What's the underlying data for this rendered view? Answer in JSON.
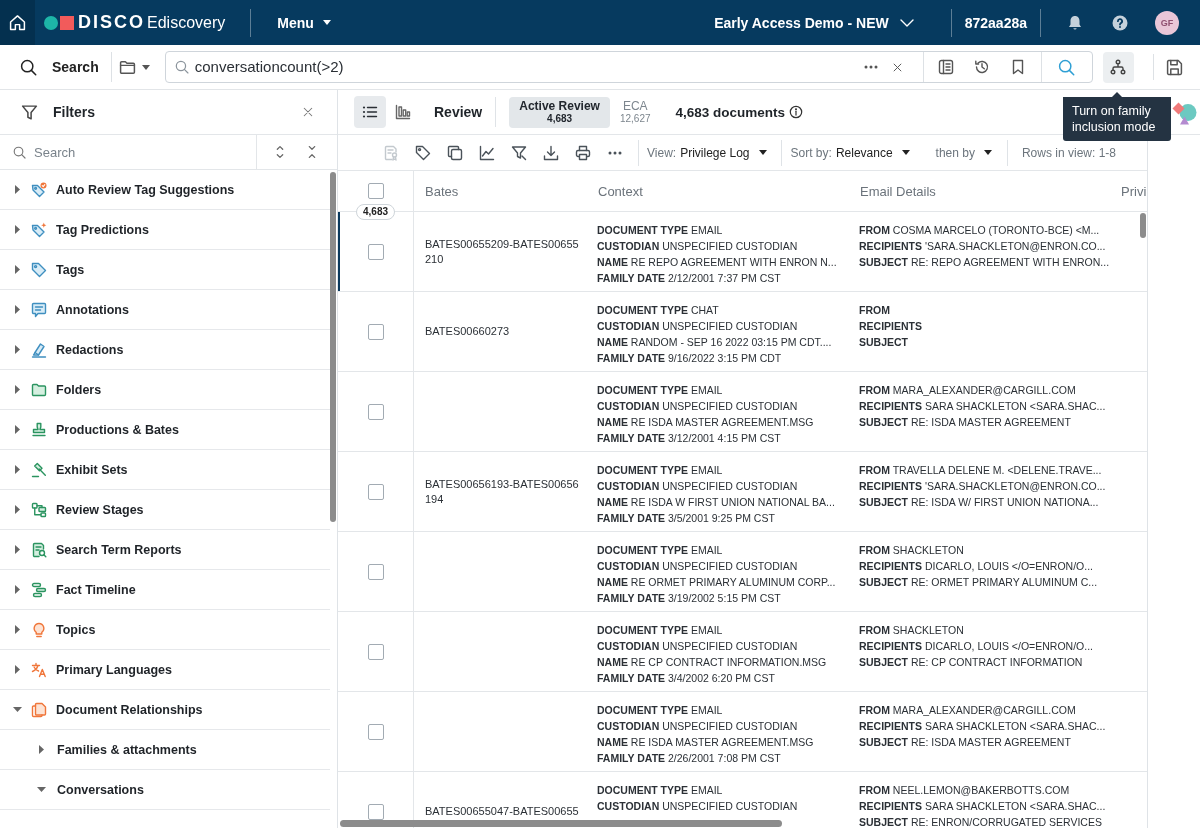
{
  "header": {
    "brand": "DISCO",
    "product": "Ediscovery",
    "menu": "Menu",
    "workspace": "Early Access Demo - NEW",
    "session_id": "872aa28a",
    "avatar": "GF"
  },
  "search_bar": {
    "label": "Search",
    "query": "conversationcount(>2)",
    "family_tooltip": "Turn on family inclusion mode"
  },
  "filters": {
    "title": "Filters",
    "search_placeholder": "Search",
    "items": [
      {
        "label": "Auto Review Tag Suggestions",
        "expanded": false
      },
      {
        "label": "Tag Predictions",
        "expanded": false
      },
      {
        "label": "Tags",
        "expanded": false
      },
      {
        "label": "Annotations",
        "expanded": false
      },
      {
        "label": "Redactions",
        "expanded": false
      },
      {
        "label": "Folders",
        "expanded": false
      },
      {
        "label": "Productions & Bates",
        "expanded": false
      },
      {
        "label": "Exhibit Sets",
        "expanded": false
      },
      {
        "label": "Review Stages",
        "expanded": false
      },
      {
        "label": "Search Term Reports",
        "expanded": false
      },
      {
        "label": "Fact Timeline",
        "expanded": false
      },
      {
        "label": "Topics",
        "expanded": false
      },
      {
        "label": "Primary Languages",
        "expanded": false
      },
      {
        "label": "Document Relationships",
        "expanded": true,
        "children": [
          {
            "label": "Families & attachments",
            "expanded": false
          },
          {
            "label": "Conversations",
            "expanded": true
          }
        ]
      }
    ]
  },
  "review": {
    "view_modes": [
      {
        "selected": true
      },
      {
        "selected": false
      }
    ],
    "title": "Review",
    "tabs": [
      {
        "label": "Active Review",
        "count": "4,683",
        "selected": true
      },
      {
        "label": "ECA",
        "count": "12,627",
        "selected": false
      }
    ],
    "summary": "4,683 documents"
  },
  "toolbar": {
    "actions": [
      {
        "disabled": true
      },
      {
        "disabled": false
      },
      {
        "disabled": false
      },
      {
        "disabled": false
      },
      {
        "disabled": false
      },
      {
        "disabled": false
      },
      {
        "disabled": false
      },
      {
        "disabled": false
      }
    ],
    "view": {
      "label": "View:",
      "value": "Privilege Log"
    },
    "sort": {
      "label": "Sort by:",
      "value": "Relevance"
    },
    "then_by": "then by",
    "rows_in_view": "Rows in view: 1-8"
  },
  "table": {
    "all_selected": false,
    "total": "4,683",
    "columns": [
      "Bates",
      "Context",
      "Email Details",
      "Privi"
    ],
    "rows": [
      {
        "selected": false,
        "current": true,
        "bates": "BATES00655209-BATES00655210",
        "context": [
          {
            "label": "DOCUMENT TYPE",
            "value": "EMAIL"
          },
          {
            "label": "CUSTODIAN",
            "value": "UNSPECIFIED CUSTODIAN"
          },
          {
            "label": "NAME",
            "value": "RE REPO AGREEMENT WITH ENRON N..."
          },
          {
            "label": "FAMILY DATE",
            "value": "2/12/2001 7:37 PM CST"
          }
        ],
        "email": [
          {
            "label": "FROM",
            "value": "COSMA MARCELO (TORONTO-BCE) <M..."
          },
          {
            "label": "RECIPIENTS",
            "value": "'SARA.SHACKLETON@ENRON.CO..."
          },
          {
            "label": "SUBJECT",
            "value": "RE: REPO AGREEMENT WITH ENRON..."
          }
        ]
      },
      {
        "selected": false,
        "current": false,
        "bates": "BATES00660273",
        "context": [
          {
            "label": "DOCUMENT TYPE",
            "value": "CHAT"
          },
          {
            "label": "CUSTODIAN",
            "value": "UNSPECIFIED CUSTODIAN"
          },
          {
            "label": "NAME",
            "value": "RANDOM - SEP 16 2022 03:15 PM CDT...."
          },
          {
            "label": "FAMILY DATE",
            "value": "9/16/2022 3:15 PM CDT"
          }
        ],
        "email": [
          {
            "label": "FROM"
          },
          {
            "label": "RECIPIENTS"
          },
          {
            "label": "SUBJECT"
          }
        ]
      },
      {
        "selected": false,
        "current": false,
        "context": [
          {
            "label": "DOCUMENT TYPE",
            "value": "EMAIL"
          },
          {
            "label": "CUSTODIAN",
            "value": "UNSPECIFIED CUSTODIAN"
          },
          {
            "label": "NAME",
            "value": "RE ISDA MASTER AGREEMENT.MSG"
          },
          {
            "label": "FAMILY DATE",
            "value": "3/12/2001 4:15 PM CST"
          }
        ],
        "email": [
          {
            "label": "FROM",
            "value": "MARA_ALEXANDER@CARGILL.COM"
          },
          {
            "label": "RECIPIENTS",
            "value": "SARA SHACKLETON <SARA.SHAC..."
          },
          {
            "label": "SUBJECT",
            "value": "RE: ISDA MASTER AGREEMENT"
          }
        ]
      },
      {
        "selected": false,
        "current": false,
        "bates": "BATES00656193-BATES00656194",
        "context": [
          {
            "label": "DOCUMENT TYPE",
            "value": "EMAIL"
          },
          {
            "label": "CUSTODIAN",
            "value": "UNSPECIFIED CUSTODIAN"
          },
          {
            "label": "NAME",
            "value": "RE ISDA W FIRST UNION NATIONAL BA..."
          },
          {
            "label": "FAMILY DATE",
            "value": "3/5/2001 9:25 PM CST"
          }
        ],
        "email": [
          {
            "label": "FROM",
            "value": "TRAVELLA DELENE M. <DELENE.TRAVE..."
          },
          {
            "label": "RECIPIENTS",
            "value": "'SARA.SHACKLETON@ENRON.CO..."
          },
          {
            "label": "SUBJECT",
            "value": "RE: ISDA W/ FIRST UNION NATIONA..."
          }
        ]
      },
      {
        "selected": false,
        "current": false,
        "context": [
          {
            "label": "DOCUMENT TYPE",
            "value": "EMAIL"
          },
          {
            "label": "CUSTODIAN",
            "value": "UNSPECIFIED CUSTODIAN"
          },
          {
            "label": "NAME",
            "value": "RE ORMET PRIMARY ALUMINUM CORP..."
          },
          {
            "label": "FAMILY DATE",
            "value": "3/19/2002 5:15 PM CST"
          }
        ],
        "email": [
          {
            "label": "FROM",
            "value": "SHACKLETON"
          },
          {
            "label": "RECIPIENTS",
            "value": "DICARLO, LOUIS </O=ENRON/O..."
          },
          {
            "label": "SUBJECT",
            "value": "RE: ORMET PRIMARY ALUMINUM C..."
          }
        ]
      },
      {
        "selected": false,
        "current": false,
        "context": [
          {
            "label": "DOCUMENT TYPE",
            "value": "EMAIL"
          },
          {
            "label": "CUSTODIAN",
            "value": "UNSPECIFIED CUSTODIAN"
          },
          {
            "label": "NAME",
            "value": "RE CP CONTRACT INFORMATION.MSG"
          },
          {
            "label": "FAMILY DATE",
            "value": "3/4/2002 6:20 PM CST"
          }
        ],
        "email": [
          {
            "label": "FROM",
            "value": "SHACKLETON"
          },
          {
            "label": "RECIPIENTS",
            "value": "DICARLO, LOUIS </O=ENRON/O..."
          },
          {
            "label": "SUBJECT",
            "value": "RE: CP CONTRACT INFORMATION"
          }
        ]
      },
      {
        "selected": false,
        "current": false,
        "context": [
          {
            "label": "DOCUMENT TYPE",
            "value": "EMAIL"
          },
          {
            "label": "CUSTODIAN",
            "value": "UNSPECIFIED CUSTODIAN"
          },
          {
            "label": "NAME",
            "value": "RE ISDA MASTER AGREEMENT.MSG"
          },
          {
            "label": "FAMILY DATE",
            "value": "2/26/2001 7:08 PM CST"
          }
        ],
        "email": [
          {
            "label": "FROM",
            "value": "MARA_ALEXANDER@CARGILL.COM"
          },
          {
            "label": "RECIPIENTS",
            "value": "SARA SHACKLETON <SARA.SHAC..."
          },
          {
            "label": "SUBJECT",
            "value": "RE: ISDA MASTER AGREEMENT"
          }
        ]
      },
      {
        "selected": false,
        "current": false,
        "bates": "BATES00655047-BATES00655",
        "context": [
          {
            "label": "DOCUMENT TYPE",
            "value": "EMAIL"
          },
          {
            "label": "CUSTODIAN",
            "value": "UNSPECIFIED CUSTODIAN"
          }
        ],
        "email": [
          {
            "label": "FROM",
            "value": "NEEL.LEMON@BAKERBOTTS.COM"
          },
          {
            "label": "RECIPIENTS",
            "value": "SARA SHACKLETON <SARA.SHAC..."
          },
          {
            "label": "SUBJECT",
            "value": "RE: ENRON/CORRUGATED SERVICES"
          }
        ]
      }
    ]
  }
}
